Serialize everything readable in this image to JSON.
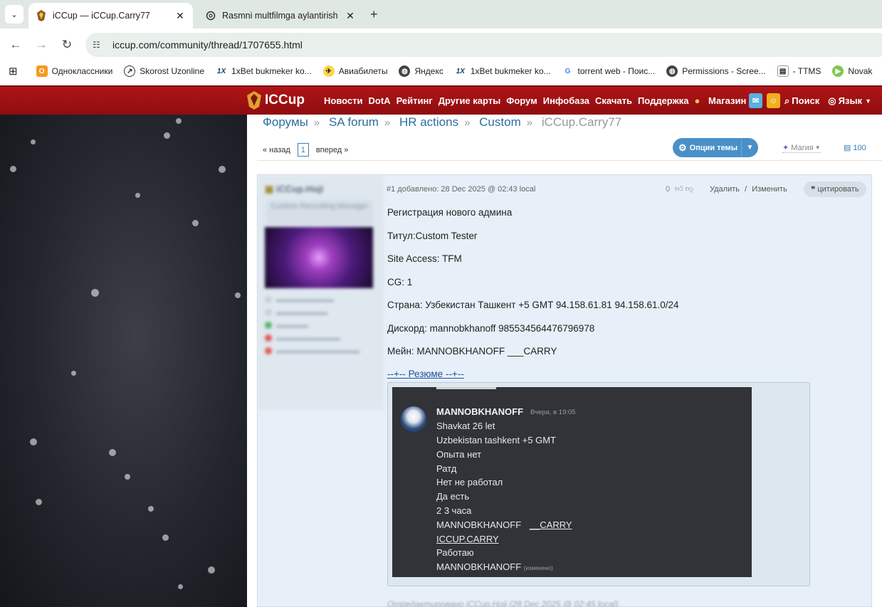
{
  "browser": {
    "tabs": [
      {
        "title": "iCCup — iCCup.Carry77",
        "active": true
      },
      {
        "title": "Rasmni multfilmga aylantirish",
        "active": false
      }
    ],
    "url": "iccup.com/community/thread/1707655.html",
    "bookmarks": [
      {
        "label": "Одноклассники",
        "icon": "ok-icon"
      },
      {
        "label": "Skorost Uzonline",
        "icon": "speed-icon"
      },
      {
        "label": "1xBet bukmeker ko...",
        "icon": "1x-icon"
      },
      {
        "label": "Авиабилеты",
        "icon": "avia-icon"
      },
      {
        "label": "Яндекс",
        "icon": "globe-icon"
      },
      {
        "label": "1xBet bukmeker ko...",
        "icon": "1x-icon"
      },
      {
        "label": "torrent web - Поис...",
        "icon": "google-icon"
      },
      {
        "label": "Permissions - Scree...",
        "icon": "globe-icon"
      },
      {
        "label": "- TTMS",
        "icon": "doc-icon"
      },
      {
        "label": "Novak",
        "icon": "play-icon"
      }
    ]
  },
  "site": {
    "logo": "ICCup",
    "nav": [
      "Новости",
      "DotA",
      "Рейтинг",
      "Другие карты",
      "Форум",
      "Инфобаза",
      "Скачать",
      "Поддержка",
      "Магазин"
    ],
    "search": "Поиск",
    "lang": "Язык"
  },
  "breadcrumbs": [
    "Форумы",
    "SA forum",
    "HR actions",
    "Custom",
    "iCCup.Carry77"
  ],
  "pager": {
    "prev": "« назад",
    "page": "1",
    "next": "вперед »"
  },
  "thread_options": "Опции темы",
  "magic": "Магия",
  "views": "100",
  "post": {
    "author": "iCCup.Hoji",
    "rank": "Custom Recruiting Manager",
    "meta": "#1 добавлено: 28 Dec 2025 @ 02:43 local",
    "votes": "0",
    "delete": "Удалить",
    "edit": "Изменить",
    "quote": "цитировать",
    "lines": [
      "Регистрация нового админа",
      "Титул:Custom Tester",
      "Site Access: TFM",
      "CG: 1",
      "Страна: Узбекистан Ташкент +5 GMT 94.158.61.81 94.158.61.0/24",
      "Дискорд: mannobkhanoff 985534564476796978",
      "Мейн: MANNOBKHANOFF ___CARRY"
    ],
    "spoiler": "--+-- Резюме --+--",
    "footer": "Отредактировано iCCup.Hoji (28 Dec 2025 @ 02:45 local)"
  },
  "discord": {
    "name": "MANNOBKHANOFF",
    "time": "Вчера, в 19:05",
    "lines": [
      "Shavkat 26 let",
      "Uzbekistan tashkent +5 GMT",
      "Опыта нет",
      "Ратд",
      "Нет не работал",
      "Да есть",
      "2 3 часа"
    ],
    "line_main": "MANNOBKHANOFF",
    "line_main_link": "__CARRY",
    "link2": "ICCUP.CARRY",
    "line_work": "Работаю",
    "last_name": "MANNOBKHANOFF",
    "edited": "(изменено)"
  },
  "colors": {
    "header_red": "#a01214",
    "link_blue": "#2b6f9e",
    "post_bg": "#e7f0f8",
    "discord_bg": "#313338"
  }
}
